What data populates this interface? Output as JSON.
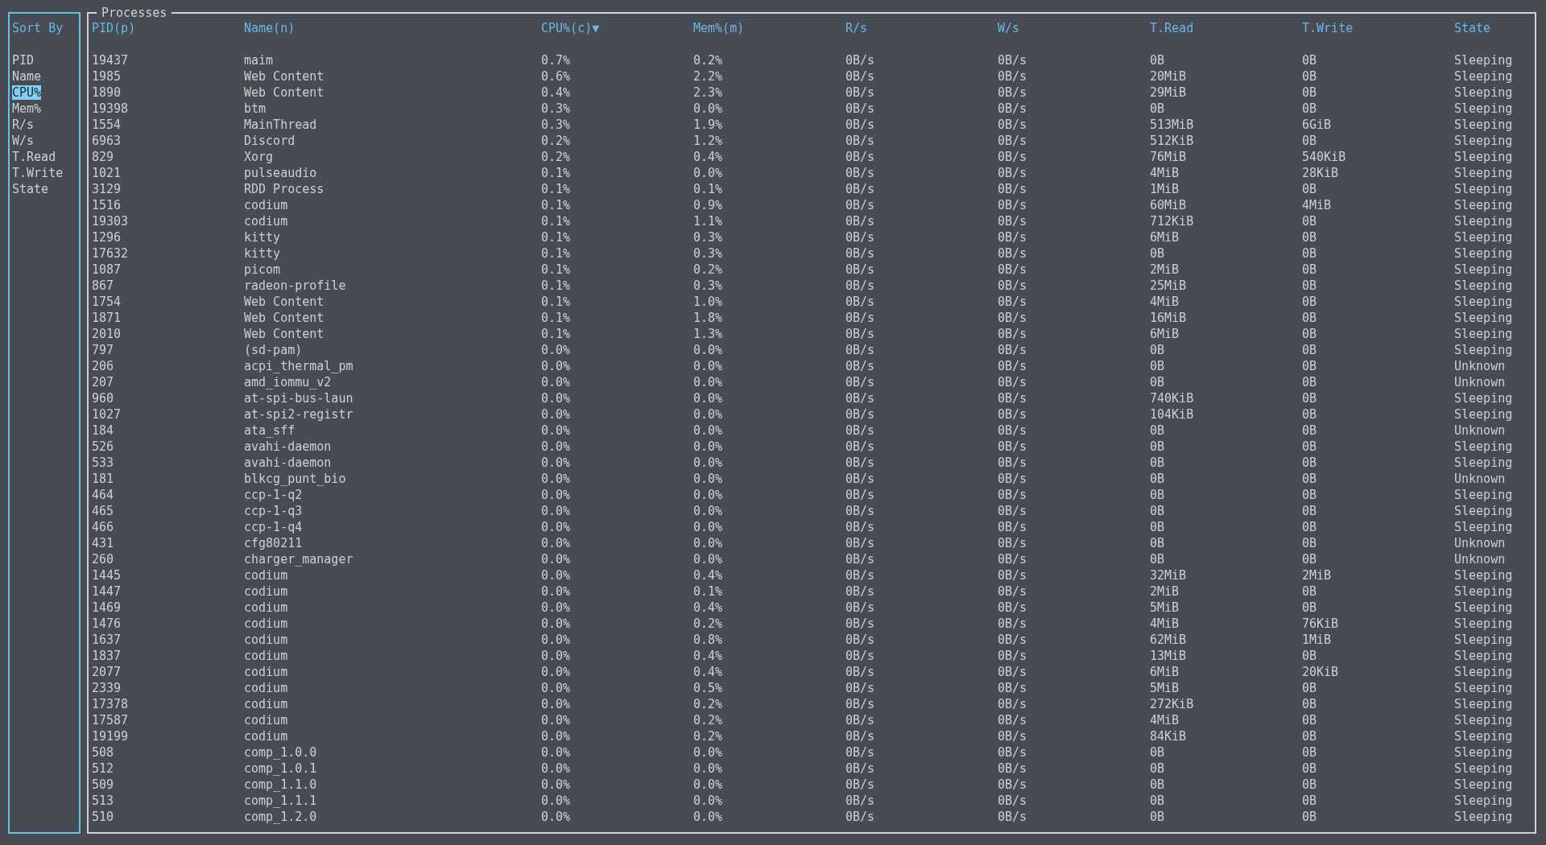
{
  "sort_panel": {
    "title": "Sort By",
    "items": [
      {
        "label": "PID",
        "selected": false
      },
      {
        "label": "Name",
        "selected": false
      },
      {
        "label": "CPU%",
        "selected": true
      },
      {
        "label": "Mem%",
        "selected": false
      },
      {
        "label": "R/s",
        "selected": false
      },
      {
        "label": "W/s",
        "selected": false
      },
      {
        "label": "T.Read",
        "selected": false
      },
      {
        "label": "T.Write",
        "selected": false
      },
      {
        "label": "State",
        "selected": false
      }
    ]
  },
  "processes": {
    "title": "Processes",
    "columns": [
      "PID(p)",
      "Name(n)",
      "CPU%(c)▼",
      "Mem%(m)",
      "R/s",
      "W/s",
      "T.Read",
      "T.Write",
      "State"
    ],
    "rows": [
      [
        "19437",
        "maim",
        "0.7%",
        "0.2%",
        "0B/s",
        "0B/s",
        "0B",
        "0B",
        "Sleeping"
      ],
      [
        "1985",
        "Web Content",
        "0.6%",
        "2.2%",
        "0B/s",
        "0B/s",
        "20MiB",
        "0B",
        "Sleeping"
      ],
      [
        "1890",
        "Web Content",
        "0.4%",
        "2.3%",
        "0B/s",
        "0B/s",
        "29MiB",
        "0B",
        "Sleeping"
      ],
      [
        "19398",
        "btm",
        "0.3%",
        "0.0%",
        "0B/s",
        "0B/s",
        "0B",
        "0B",
        "Sleeping"
      ],
      [
        "1554",
        "MainThread",
        "0.3%",
        "1.9%",
        "0B/s",
        "0B/s",
        "513MiB",
        "6GiB",
        "Sleeping"
      ],
      [
        "6963",
        "Discord",
        "0.2%",
        "1.2%",
        "0B/s",
        "0B/s",
        "512KiB",
        "0B",
        "Sleeping"
      ],
      [
        "829",
        "Xorg",
        "0.2%",
        "0.4%",
        "0B/s",
        "0B/s",
        "76MiB",
        "540KiB",
        "Sleeping"
      ],
      [
        "1021",
        "pulseaudio",
        "0.1%",
        "0.0%",
        "0B/s",
        "0B/s",
        "4MiB",
        "28KiB",
        "Sleeping"
      ],
      [
        "3129",
        "RDD Process",
        "0.1%",
        "0.1%",
        "0B/s",
        "0B/s",
        "1MiB",
        "0B",
        "Sleeping"
      ],
      [
        "1516",
        "codium",
        "0.1%",
        "0.9%",
        "0B/s",
        "0B/s",
        "60MiB",
        "4MiB",
        "Sleeping"
      ],
      [
        "19303",
        "codium",
        "0.1%",
        "1.1%",
        "0B/s",
        "0B/s",
        "712KiB",
        "0B",
        "Sleeping"
      ],
      [
        "1296",
        "kitty",
        "0.1%",
        "0.3%",
        "0B/s",
        "0B/s",
        "6MiB",
        "0B",
        "Sleeping"
      ],
      [
        "17632",
        "kitty",
        "0.1%",
        "0.3%",
        "0B/s",
        "0B/s",
        "0B",
        "0B",
        "Sleeping"
      ],
      [
        "1087",
        "picom",
        "0.1%",
        "0.2%",
        "0B/s",
        "0B/s",
        "2MiB",
        "0B",
        "Sleeping"
      ],
      [
        "867",
        "radeon-profile",
        "0.1%",
        "0.3%",
        "0B/s",
        "0B/s",
        "25MiB",
        "0B",
        "Sleeping"
      ],
      [
        "1754",
        "Web Content",
        "0.1%",
        "1.0%",
        "0B/s",
        "0B/s",
        "4MiB",
        "0B",
        "Sleeping"
      ],
      [
        "1871",
        "Web Content",
        "0.1%",
        "1.8%",
        "0B/s",
        "0B/s",
        "16MiB",
        "0B",
        "Sleeping"
      ],
      [
        "2010",
        "Web Content",
        "0.1%",
        "1.3%",
        "0B/s",
        "0B/s",
        "6MiB",
        "0B",
        "Sleeping"
      ],
      [
        "797",
        "(sd-pam)",
        "0.0%",
        "0.0%",
        "0B/s",
        "0B/s",
        "0B",
        "0B",
        "Sleeping"
      ],
      [
        "206",
        "acpi_thermal_pm",
        "0.0%",
        "0.0%",
        "0B/s",
        "0B/s",
        "0B",
        "0B",
        "Unknown"
      ],
      [
        "207",
        "amd_iommu_v2",
        "0.0%",
        "0.0%",
        "0B/s",
        "0B/s",
        "0B",
        "0B",
        "Unknown"
      ],
      [
        "960",
        "at-spi-bus-laun",
        "0.0%",
        "0.0%",
        "0B/s",
        "0B/s",
        "740KiB",
        "0B",
        "Sleeping"
      ],
      [
        "1027",
        "at-spi2-registr",
        "0.0%",
        "0.0%",
        "0B/s",
        "0B/s",
        "104KiB",
        "0B",
        "Sleeping"
      ],
      [
        "184",
        "ata_sff",
        "0.0%",
        "0.0%",
        "0B/s",
        "0B/s",
        "0B",
        "0B",
        "Unknown"
      ],
      [
        "526",
        "avahi-daemon",
        "0.0%",
        "0.0%",
        "0B/s",
        "0B/s",
        "0B",
        "0B",
        "Sleeping"
      ],
      [
        "533",
        "avahi-daemon",
        "0.0%",
        "0.0%",
        "0B/s",
        "0B/s",
        "0B",
        "0B",
        "Sleeping"
      ],
      [
        "181",
        "blkcg_punt_bio",
        "0.0%",
        "0.0%",
        "0B/s",
        "0B/s",
        "0B",
        "0B",
        "Unknown"
      ],
      [
        "464",
        "ccp-1-q2",
        "0.0%",
        "0.0%",
        "0B/s",
        "0B/s",
        "0B",
        "0B",
        "Sleeping"
      ],
      [
        "465",
        "ccp-1-q3",
        "0.0%",
        "0.0%",
        "0B/s",
        "0B/s",
        "0B",
        "0B",
        "Sleeping"
      ],
      [
        "466",
        "ccp-1-q4",
        "0.0%",
        "0.0%",
        "0B/s",
        "0B/s",
        "0B",
        "0B",
        "Sleeping"
      ],
      [
        "431",
        "cfg80211",
        "0.0%",
        "0.0%",
        "0B/s",
        "0B/s",
        "0B",
        "0B",
        "Unknown"
      ],
      [
        "260",
        "charger_manager",
        "0.0%",
        "0.0%",
        "0B/s",
        "0B/s",
        "0B",
        "0B",
        "Unknown"
      ],
      [
        "1445",
        "codium",
        "0.0%",
        "0.4%",
        "0B/s",
        "0B/s",
        "32MiB",
        "2MiB",
        "Sleeping"
      ],
      [
        "1447",
        "codium",
        "0.0%",
        "0.1%",
        "0B/s",
        "0B/s",
        "2MiB",
        "0B",
        "Sleeping"
      ],
      [
        "1469",
        "codium",
        "0.0%",
        "0.4%",
        "0B/s",
        "0B/s",
        "5MiB",
        "0B",
        "Sleeping"
      ],
      [
        "1476",
        "codium",
        "0.0%",
        "0.2%",
        "0B/s",
        "0B/s",
        "4MiB",
        "76KiB",
        "Sleeping"
      ],
      [
        "1637",
        "codium",
        "0.0%",
        "0.8%",
        "0B/s",
        "0B/s",
        "62MiB",
        "1MiB",
        "Sleeping"
      ],
      [
        "1837",
        "codium",
        "0.0%",
        "0.4%",
        "0B/s",
        "0B/s",
        "13MiB",
        "0B",
        "Sleeping"
      ],
      [
        "2077",
        "codium",
        "0.0%",
        "0.4%",
        "0B/s",
        "0B/s",
        "6MiB",
        "20KiB",
        "Sleeping"
      ],
      [
        "2339",
        "codium",
        "0.0%",
        "0.5%",
        "0B/s",
        "0B/s",
        "5MiB",
        "0B",
        "Sleeping"
      ],
      [
        "17378",
        "codium",
        "0.0%",
        "0.2%",
        "0B/s",
        "0B/s",
        "272KiB",
        "0B",
        "Sleeping"
      ],
      [
        "17587",
        "codium",
        "0.0%",
        "0.2%",
        "0B/s",
        "0B/s",
        "4MiB",
        "0B",
        "Sleeping"
      ],
      [
        "19199",
        "codium",
        "0.0%",
        "0.2%",
        "0B/s",
        "0B/s",
        "84KiB",
        "0B",
        "Sleeping"
      ],
      [
        "508",
        "comp_1.0.0",
        "0.0%",
        "0.0%",
        "0B/s",
        "0B/s",
        "0B",
        "0B",
        "Sleeping"
      ],
      [
        "512",
        "comp_1.0.1",
        "0.0%",
        "0.0%",
        "0B/s",
        "0B/s",
        "0B",
        "0B",
        "Sleeping"
      ],
      [
        "509",
        "comp_1.1.0",
        "0.0%",
        "0.0%",
        "0B/s",
        "0B/s",
        "0B",
        "0B",
        "Sleeping"
      ],
      [
        "513",
        "comp_1.1.1",
        "0.0%",
        "0.0%",
        "0B/s",
        "0B/s",
        "0B",
        "0B",
        "Sleeping"
      ],
      [
        "510",
        "comp_1.2.0",
        "0.0%",
        "0.0%",
        "0B/s",
        "0B/s",
        "0B",
        "0B",
        "Sleeping"
      ]
    ]
  }
}
